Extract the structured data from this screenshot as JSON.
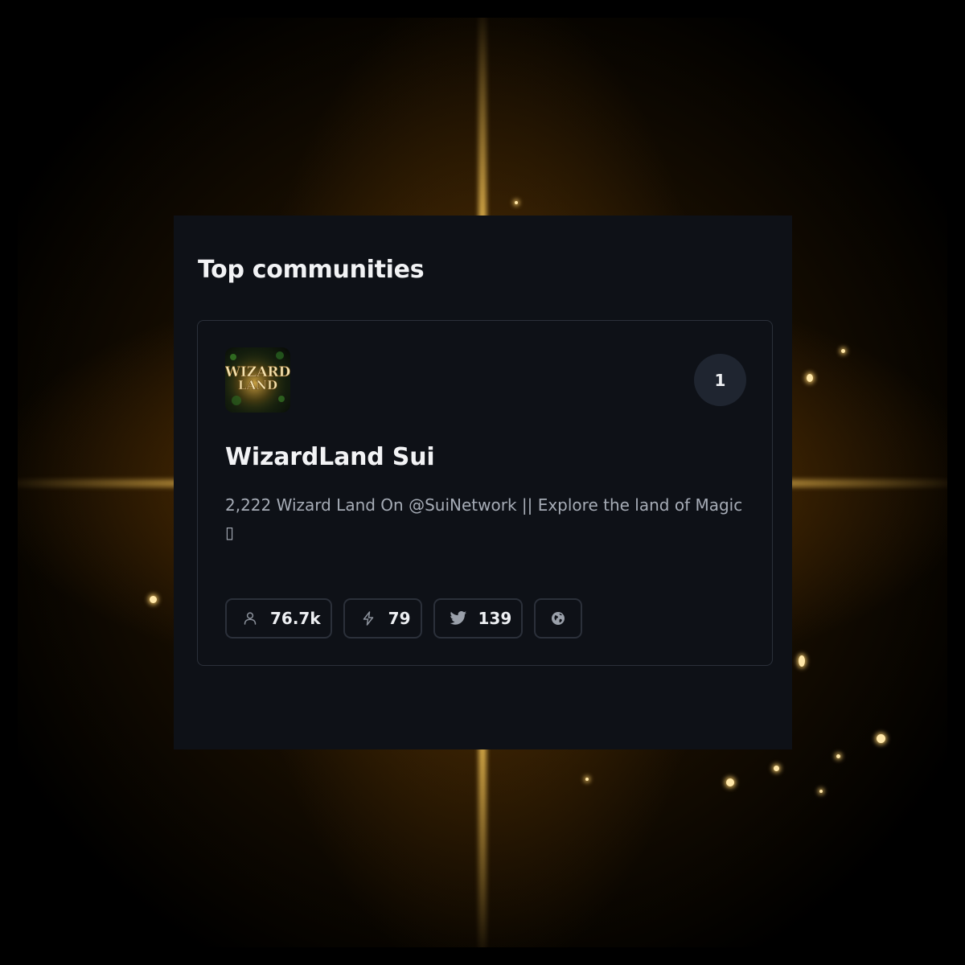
{
  "panel": {
    "title": "Top communities"
  },
  "community": {
    "rank": "1",
    "avatar_text_line1": "WIZARD",
    "avatar_text_line2": "LAND",
    "name": "WizardLand Sui",
    "description": "2,222 Wizard Land On @SuiNetwork || Explore the land of Magic ▯",
    "stats": {
      "members": "76.7k",
      "activity": "79",
      "twitter": "139"
    },
    "icons": {
      "members": "user-icon",
      "activity": "lightning-icon",
      "twitter": "twitter-icon",
      "website": "globe-icon"
    }
  },
  "theme": {
    "panel_bg": "#0e1117",
    "card_border": "#2b303a",
    "text_primary": "#f2f3f5",
    "text_secondary": "#a6acb6",
    "badge_bg": "#1f2530",
    "glow_gold": "#ffb01c"
  }
}
